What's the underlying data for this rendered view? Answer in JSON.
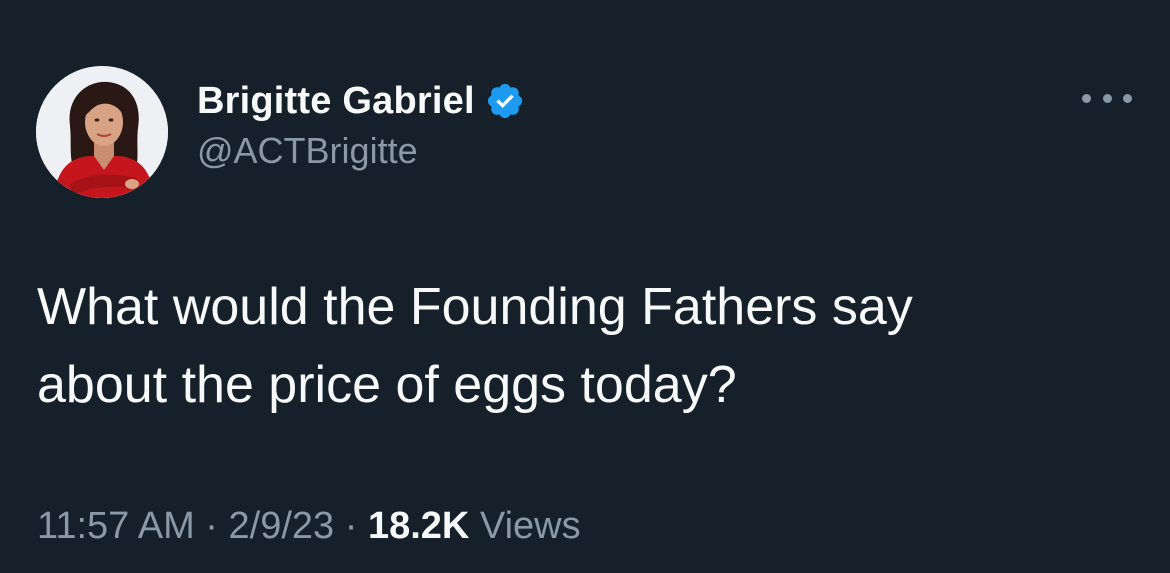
{
  "author": {
    "display_name": "Brigitte Gabriel",
    "handle": "@ACTBrigitte",
    "avatar_icon": "profile-photo",
    "verified_icon": "verified-badge-icon",
    "verified_color": "#1d9bf0"
  },
  "menu": {
    "more_icon": "more-options-icon"
  },
  "tweet": {
    "text": "What would the Founding Fathers say\nabout the price of eggs today?"
  },
  "meta": {
    "time": "11:57 AM",
    "separator_1": " · ",
    "date": "2/9/23",
    "separator_2": " · ",
    "views_count": "18.2K",
    "views_label": " Views"
  },
  "theme": {
    "background": "#15202b",
    "primary_text": "#f7f9f9",
    "secondary_text": "#8b98a5"
  }
}
